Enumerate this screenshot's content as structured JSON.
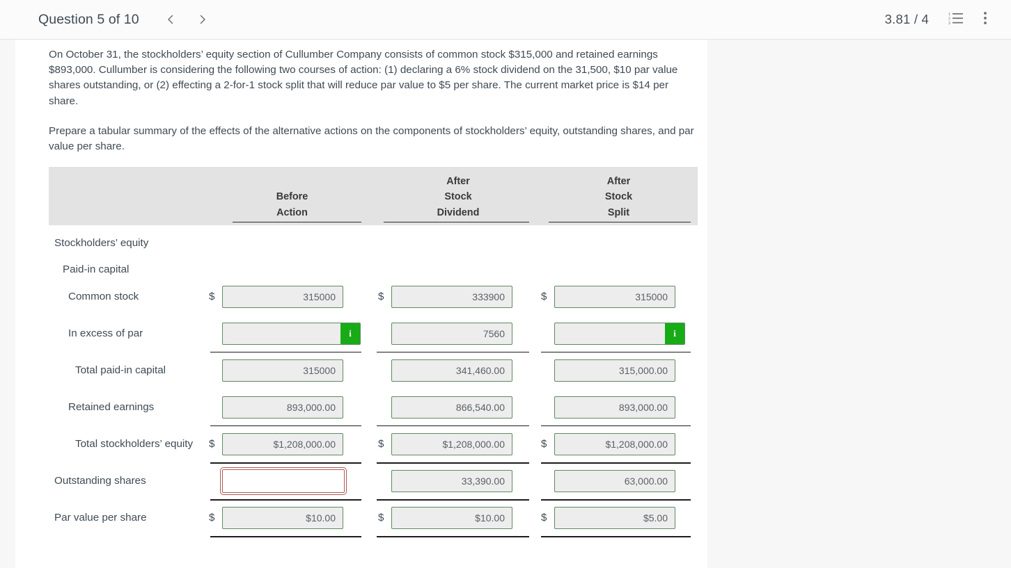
{
  "topbar": {
    "question_label": "Question 5 of 10",
    "prev_icon": "chevron-left-icon",
    "next_icon": "chevron-right-icon",
    "score": "3.81 / 4",
    "list_icon": "numbered-list-icon",
    "menu_icon": "more-vertical-icon"
  },
  "question": {
    "paragraph1": "On October 31, the stockholders’ equity section of Cullumber Company consists of common stock $315,000 and retained earnings $893,000. Cullumber is considering the following two courses of action: (1) declaring a 6% stock dividend on the 31,500, $10 par value shares outstanding, or (2) effecting a 2-for-1 stock split that will reduce par value to $5 per share. The current market price is $14 per share.",
    "paragraph2": "Prepare a tabular summary of the effects of the alternative actions on the components of stockholders’ equity, outstanding shares, and par value per share."
  },
  "table": {
    "columns": [
      {
        "line1": "",
        "line2": "Before",
        "line3": "Action"
      },
      {
        "line1": "After",
        "line2": "Stock",
        "line3": "Dividend"
      },
      {
        "line1": "After",
        "line2": "Stock",
        "line3": "Split"
      }
    ],
    "rows": {
      "stockholders_equity": {
        "label": "Stockholders’ equity"
      },
      "paid_in_capital": {
        "label": "Paid-in capital"
      },
      "common_stock": {
        "label": "Common stock",
        "c1": {
          "prefix": "$",
          "value": "315000"
        },
        "c2": {
          "prefix": "$",
          "value": "333900"
        },
        "c3": {
          "prefix": "$",
          "value": "315000"
        }
      },
      "in_excess_of_par": {
        "label": "In excess of par",
        "c1": {
          "prefix": "",
          "value": "",
          "badge": "i"
        },
        "c2": {
          "prefix": "",
          "value": "7560"
        },
        "c3": {
          "prefix": "",
          "value": "",
          "badge": "i"
        }
      },
      "total_paid_in_capital": {
        "label": "Total paid-in capital",
        "c1": {
          "prefix": "",
          "value": "315000"
        },
        "c2": {
          "prefix": "",
          "value": "341,460.00"
        },
        "c3": {
          "prefix": "",
          "value": "315,000.00"
        }
      },
      "retained_earnings": {
        "label": "Retained earnings",
        "c1": {
          "prefix": "",
          "value": "893,000.00"
        },
        "c2": {
          "prefix": "",
          "value": "866,540.00"
        },
        "c3": {
          "prefix": "",
          "value": "893,000.00"
        }
      },
      "total_stockholders_equity": {
        "label": "Total stockholders’ equity",
        "c1": {
          "prefix": "$",
          "value": "$1,208,000.00"
        },
        "c2": {
          "prefix": "$",
          "value": "$1,208,000.00"
        },
        "c3": {
          "prefix": "$",
          "value": "$1,208,000.00"
        }
      },
      "outstanding_shares": {
        "label": "Outstanding shares",
        "c1": {
          "prefix": "",
          "value": "",
          "state": "error"
        },
        "c2": {
          "prefix": "",
          "value": "33,390.00"
        },
        "c3": {
          "prefix": "",
          "value": "63,000.00"
        }
      },
      "par_value_per_share": {
        "label": "Par value per share",
        "c1": {
          "prefix": "$",
          "value": "$10.00"
        },
        "c2": {
          "prefix": "$",
          "value": "$10.00"
        },
        "c3": {
          "prefix": "$",
          "value": "$5.00"
        }
      }
    }
  },
  "colors": {
    "input_border_green": "#5f8a5f",
    "input_fill": "#ededed",
    "badge_green": "#17ac17",
    "error_red": "#b05a52",
    "header_band": "#e3e3e3",
    "text": "#3f4a54"
  }
}
